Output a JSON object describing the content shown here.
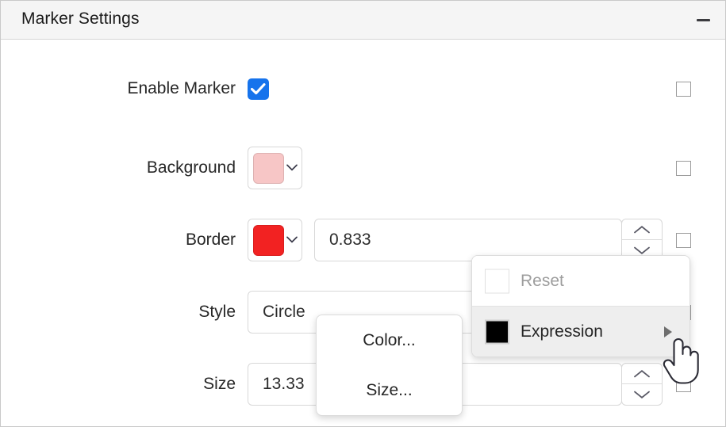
{
  "panel": {
    "title": "Marker Settings",
    "collapse_icon": "minus-icon"
  },
  "rows": [
    {
      "label": "Enable Marker",
      "control": "checkbox",
      "checked": true,
      "override_checked": false
    },
    {
      "label": "Background",
      "control": "color-swatch",
      "swatch_color": "#F7C6C6",
      "override_checked": false
    },
    {
      "label": "Border",
      "control": "color-swatch-number",
      "swatch_color": "#F22222",
      "value": "0.833",
      "override_checked": false
    },
    {
      "label": "Style",
      "control": "dropdown",
      "value": "Circle",
      "override_checked": false
    },
    {
      "label": "Size",
      "control": "number",
      "value": "13.33",
      "override_checked": false
    }
  ],
  "context_menu": {
    "items": [
      {
        "label": "Reset",
        "icon": "empty-square-icon",
        "disabled": true,
        "highlight": false,
        "has_submenu": false
      },
      {
        "label": "Expression",
        "icon": "black-square-icon",
        "disabled": false,
        "highlight": true,
        "has_submenu": true
      }
    ]
  },
  "submenu": {
    "items": [
      {
        "label": "Color..."
      },
      {
        "label": "Size..."
      }
    ]
  },
  "cursor": {
    "type": "pointing-hand-cursor"
  },
  "colors": {
    "accent": "#1673EC",
    "header_bg": "#F5F5F5",
    "border": "#D8D8D8",
    "menu_highlight": "#EEEEEE"
  }
}
